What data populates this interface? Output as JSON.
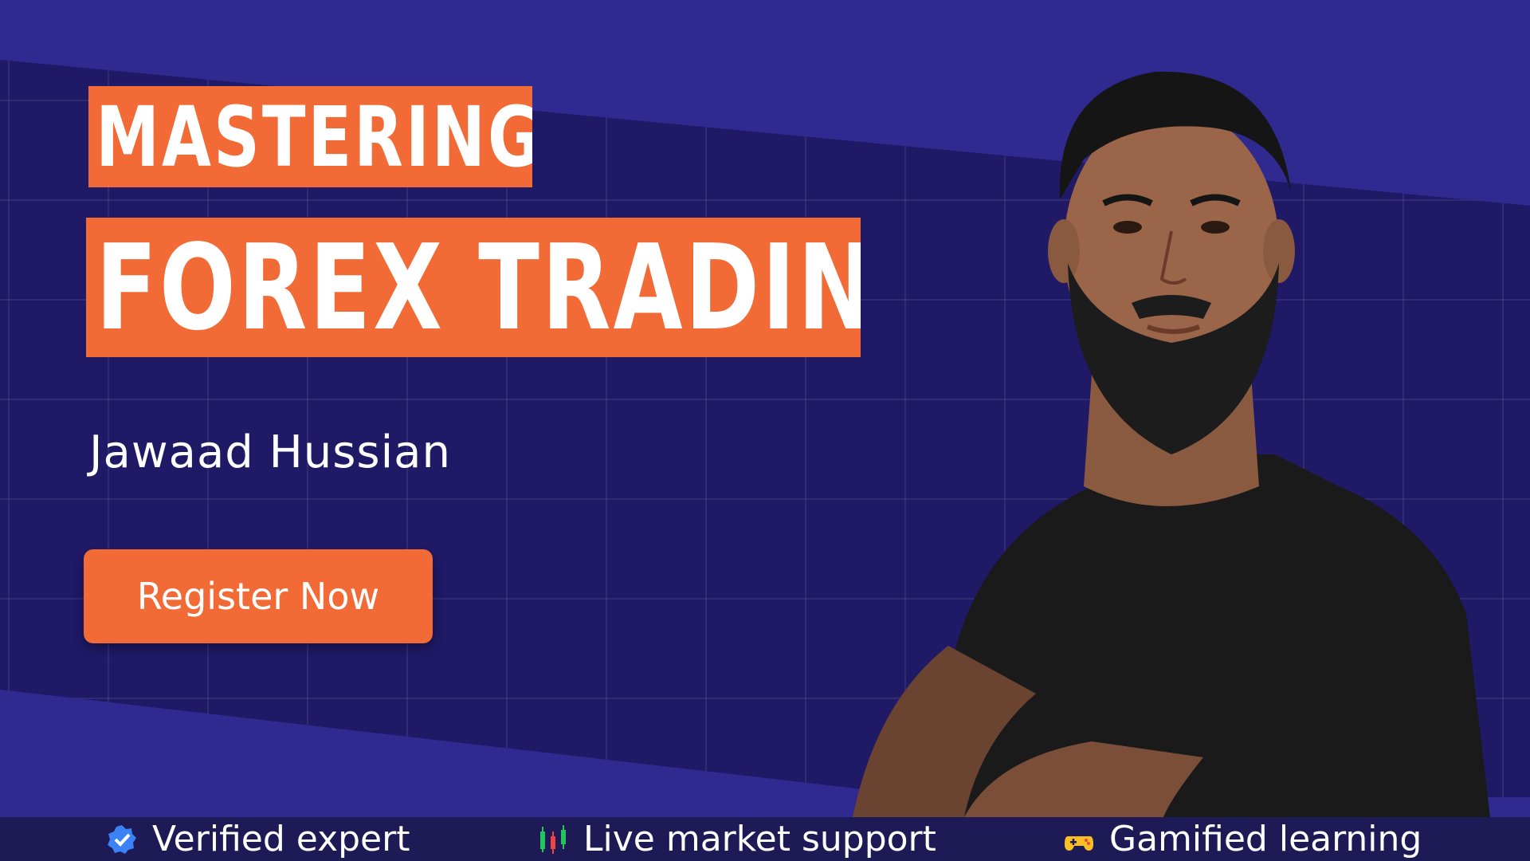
{
  "hero": {
    "title_line1": "MASTERING",
    "title_line2": "FOREX TRADING",
    "author": "Jawaad Hussian",
    "register_label": "Register Now"
  },
  "features": [
    {
      "label": "Verified expert",
      "icon": "verified-badge-icon"
    },
    {
      "label": "Live market support",
      "icon": "candlestick-chart-icon"
    },
    {
      "label": "Gamified learning",
      "icon": "game-controller-icon"
    }
  ],
  "colors": {
    "background": "#30298f",
    "band": "#1f1966",
    "accent": "#f26b36",
    "bottom_bar": "#1d1a55"
  }
}
